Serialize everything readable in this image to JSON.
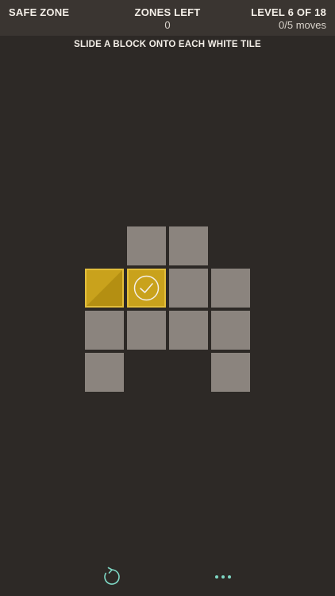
{
  "header": {
    "left_title": "SAFE ZONE",
    "center_title": "ZONES LEFT",
    "center_value": "0",
    "right_title": "LEVEL 6 OF 18",
    "right_value": "0/5 moves"
  },
  "instruction": "SLIDE A BLOCK ONTO EACH WHITE TILE",
  "board": {
    "tile_color": "#8b847e",
    "block_color": "#c9a21c",
    "rows": [
      [
        "empty",
        "tile",
        "tile",
        "empty"
      ],
      [
        "block",
        "block-on-target",
        "tile",
        "tile"
      ],
      [
        "tile",
        "tile",
        "tile",
        "tile"
      ],
      [
        "tile",
        "empty",
        "empty",
        "tile"
      ]
    ]
  },
  "controls": {
    "accent_color": "#7fd9c6",
    "icons": [
      "refresh-icon",
      "more-icon"
    ]
  }
}
